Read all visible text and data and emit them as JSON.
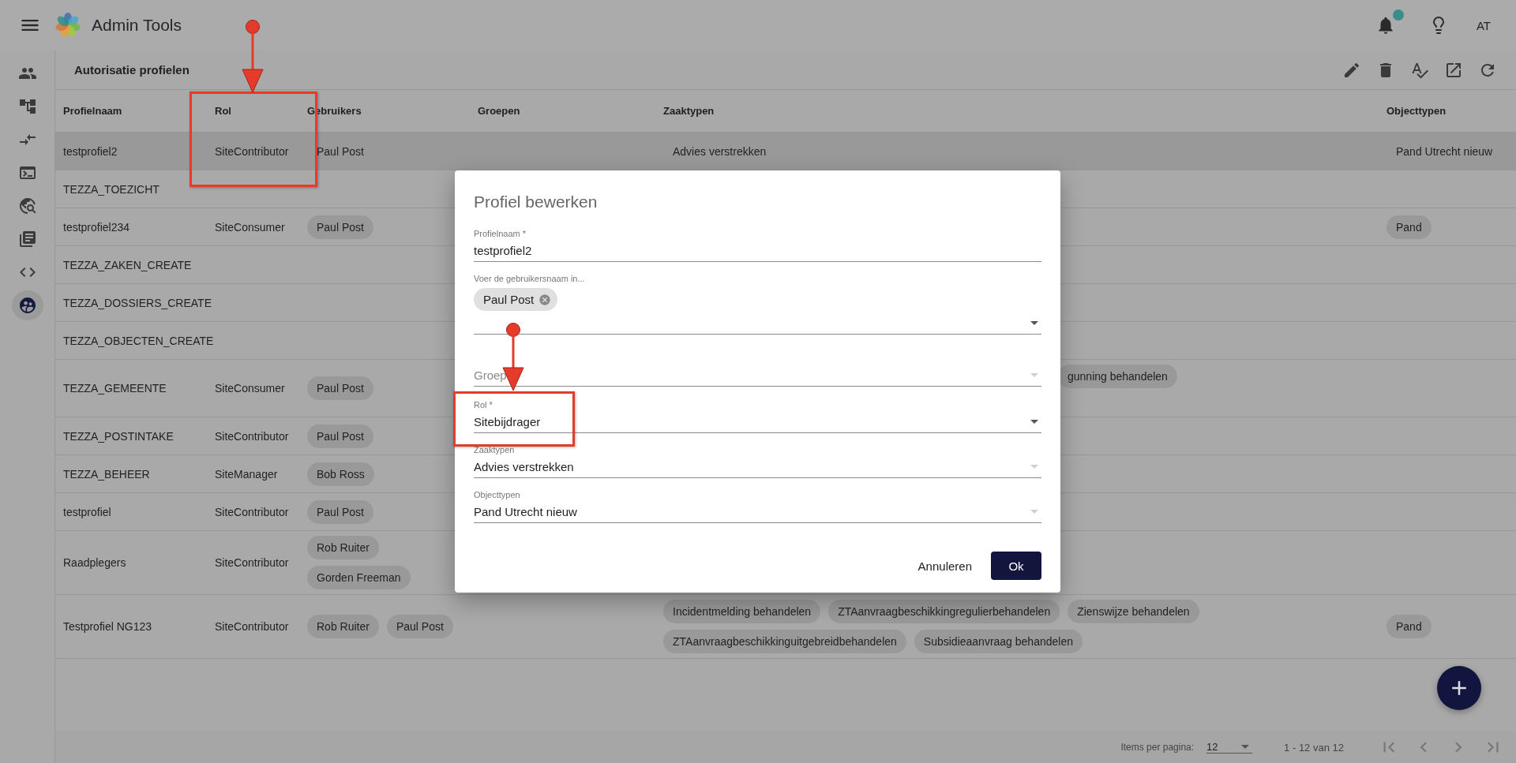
{
  "app": {
    "title": "Admin Tools",
    "user_initials": "AT",
    "notifications": {
      "badge": true
    }
  },
  "sidebar": {
    "items": [
      {
        "kind": "people",
        "selected": false
      },
      {
        "kind": "tree",
        "selected": false
      },
      {
        "kind": "arrows",
        "selected": false
      },
      {
        "kind": "terminal",
        "selected": false
      },
      {
        "kind": "globe",
        "selected": false
      },
      {
        "kind": "books",
        "selected": false
      },
      {
        "kind": "code",
        "selected": false
      },
      {
        "kind": "users",
        "selected": true
      }
    ]
  },
  "page": {
    "title": "Autorisatie profielen"
  },
  "table": {
    "columns": [
      "Profielnaam",
      "Rol",
      "Gebruikers",
      "Groepen",
      "Zaaktypen",
      "Objecttypen"
    ],
    "rows": [
      {
        "name": "testprofiel2",
        "role": "SiteContributor",
        "users": [
          "Paul Post"
        ],
        "zaaktypen": [
          {
            "label": "Advies verstrekken",
            "kind": "chip"
          }
        ],
        "objecttypen": [
          "Pand Utrecht nieuw"
        ],
        "selected": true
      },
      {
        "name": "TEZZA_TOEZICHT",
        "selected": false
      },
      {
        "name": "testprofiel234",
        "role": "SiteConsumer",
        "users": [
          "Paul Post"
        ],
        "objecttypen": [
          "Pand"
        ],
        "selected": false
      },
      {
        "name": "TEZZA_ZAKEN_CREATE",
        "selected": false
      },
      {
        "name": "TEZZA_DOSSIERS_CREATE",
        "selected": false
      },
      {
        "name": "TEZZA_OBJECTEN_CREATE",
        "selected": false
      },
      {
        "name": "TEZZA_GEMEENTE",
        "role": "SiteConsumer",
        "users": [
          "Paul Post"
        ],
        "zaaktypen": [
          {
            "label": "gunning behandelen",
            "kind": "cut"
          }
        ],
        "selected": false
      },
      {
        "name": "TEZZA_POSTINTAKE",
        "role": "SiteContributor",
        "users": [
          "Paul Post"
        ],
        "selected": false
      },
      {
        "name": "TEZZA_BEHEER",
        "role": "SiteManager",
        "users": [
          "Bob Ross"
        ],
        "selected": false
      },
      {
        "name": "testprofiel",
        "role": "SiteContributor",
        "users": [
          "Paul Post"
        ],
        "selected": false
      },
      {
        "name": "Raadplegers",
        "role": "SiteContributor",
        "users": [
          "Rob Ruiter",
          "Gorden Freeman"
        ],
        "selected": false
      },
      {
        "name": "Testprofiel NG123",
        "role": "SiteContributor",
        "users": [
          "Rob Ruiter",
          "Paul Post"
        ],
        "zaaktypen": [
          {
            "label": "Incidentmelding behandelen",
            "kind": "chip"
          },
          {
            "label": "ZTAanvraagbeschikkingregulierbehandelen",
            "kind": "chip"
          },
          {
            "label": "Zienswijze behandelen",
            "kind": "chip"
          },
          {
            "label": "ZTAanvraagbeschikkinguitgebreidbehandelen",
            "kind": "chip"
          },
          {
            "label": "Subsidieaanvraag behandelen",
            "kind": "chip"
          }
        ],
        "objecttypen": [
          "Pand"
        ],
        "selected": false
      }
    ]
  },
  "pagination": {
    "items_label": "Items per pagina:",
    "page_size": "12",
    "range": "1 - 12 van 12"
  },
  "dialog": {
    "title": "Profiel bewerken",
    "fields": [
      {
        "kind": "text",
        "label": "Profielnaam *",
        "value": "testprofiel2"
      },
      {
        "kind": "chips",
        "label": "Voer de gebruikersnaam in...",
        "chips": [
          "Paul Post"
        ],
        "disabled": false
      },
      {
        "kind": "select",
        "placeholder": "Groep",
        "disabled": true
      },
      {
        "kind": "select",
        "label": "Rol *",
        "value": "Sitebijdrager",
        "disabled": false
      },
      {
        "kind": "select",
        "label": "Zaaktypen",
        "value": "Advies verstrekken",
        "disabled": true
      },
      {
        "kind": "select",
        "label": "Objecttypen",
        "value": "Pand Utrecht nieuw",
        "disabled": true
      }
    ],
    "cancel": "Annuleren",
    "ok": "Ok"
  }
}
